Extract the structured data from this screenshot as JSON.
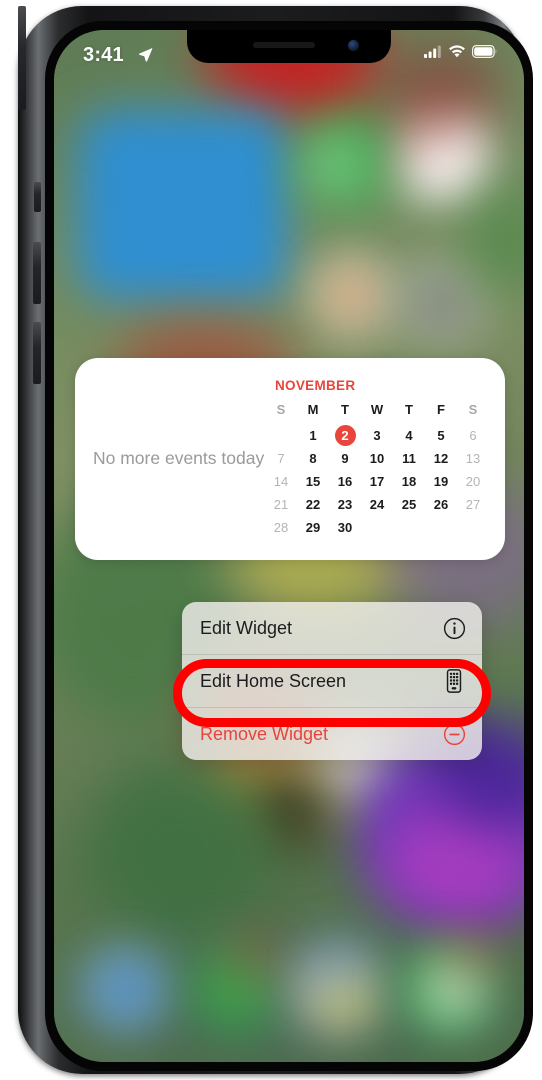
{
  "device": {
    "name": "iPhone",
    "orientation": "portrait"
  },
  "status_bar": {
    "time": "3:41",
    "location_icon": "location-arrow-icon",
    "cellular_icon": "cellular-bars-icon",
    "wifi_icon": "wifi-icon",
    "battery_icon": "battery-full-icon"
  },
  "widget": {
    "type": "calendar",
    "events_text": "No more events today",
    "month": "NOVEMBER",
    "day_headers": [
      "S",
      "M",
      "T",
      "W",
      "T",
      "F",
      "S"
    ],
    "today": 2,
    "leading_blanks": 1,
    "days": [
      1,
      2,
      3,
      4,
      5,
      6,
      7,
      8,
      9,
      10,
      11,
      12,
      13,
      14,
      15,
      16,
      17,
      18,
      19,
      20,
      21,
      22,
      23,
      24,
      25,
      26,
      27,
      28,
      29,
      30
    ],
    "weekend_columns": [
      0,
      6
    ],
    "accent_color": "#E8453C",
    "events_text_color": "#9a9a9e"
  },
  "context_menu": {
    "items": [
      {
        "label": "Edit Widget",
        "icon": "info-circle-icon",
        "destructive": false
      },
      {
        "label": "Edit Home Screen",
        "icon": "home-screen-grid-icon",
        "destructive": false
      },
      {
        "label": "Remove Widget",
        "icon": "minus-circle-icon",
        "destructive": true
      }
    ],
    "destructive_color": "#E8443C"
  },
  "annotation": {
    "shape": "oval",
    "color": "#FF0000",
    "targets": "Edit Home Screen"
  },
  "wallpaper": {
    "description": "blurred home screen with app icons",
    "dock_icon_colors": [
      "#3a7fd5",
      "#2fab4f",
      "#d8cf3a",
      "#e8f0e4"
    ]
  }
}
